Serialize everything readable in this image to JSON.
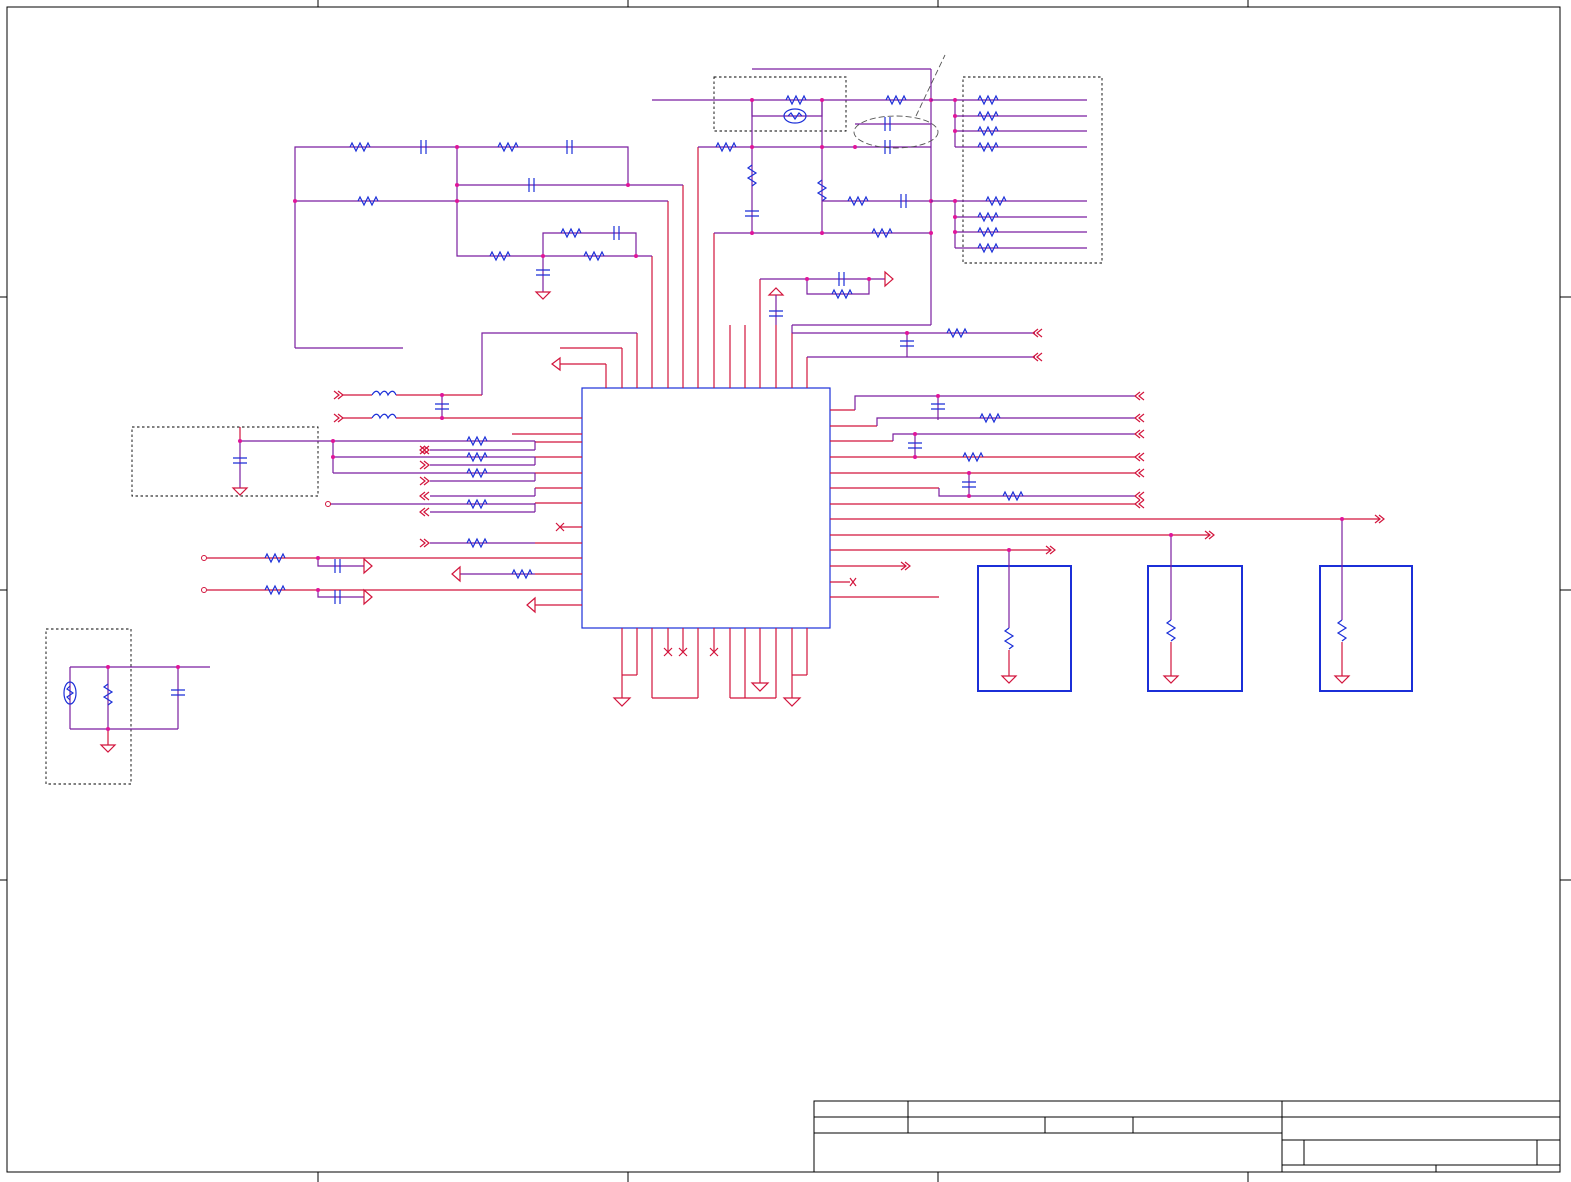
{
  "sheet": {
    "colors": {
      "wire": "#d2143c",
      "net": "#7a1fa0",
      "component": "#1b2fd8",
      "junction": "#e0159a",
      "border": "#000000"
    },
    "components": {
      "main_ic": "integrated-circuit",
      "resistor_icon": "zigzag-resistor",
      "capacitor_icon": "two-plate-capacitor",
      "crystal_icon": "crystal-oscillator",
      "ground_icon": "triangle-ground",
      "port_icon": "double-chevron-port"
    },
    "title_block": {
      "rows": 3,
      "text": ""
    }
  }
}
